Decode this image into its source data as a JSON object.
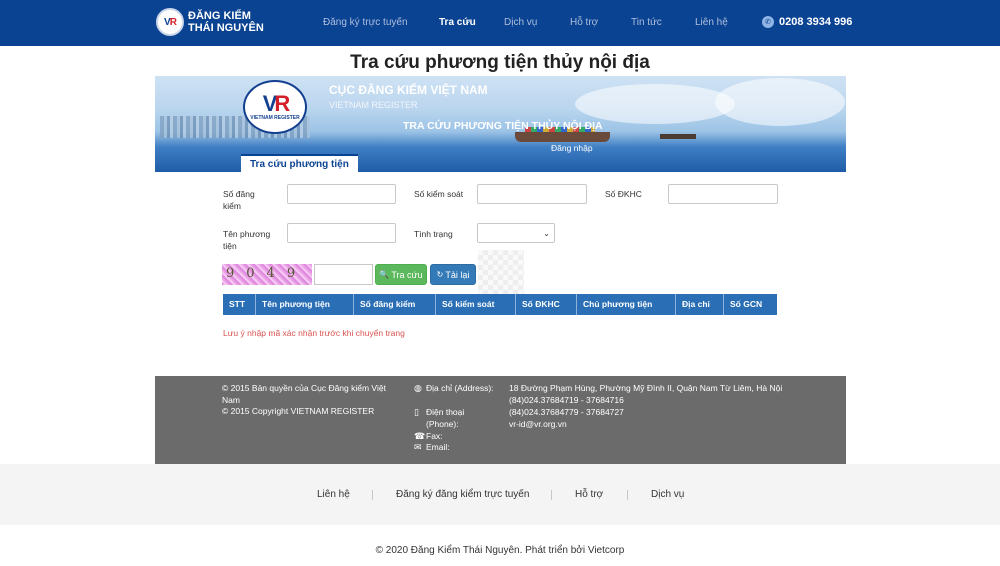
{
  "brand": {
    "logo_text": "VR",
    "line1": "ĐĂNG KIỂM",
    "line2": "THÁI NGUYÊN"
  },
  "nav": {
    "items": [
      "Đăng ký trực tuyến",
      "Tra cứu",
      "Dịch vụ",
      "Hỗ trợ",
      "Tin tức",
      "Liên hệ"
    ],
    "active": "Tra cứu",
    "phone": "0208 3934 996"
  },
  "page": {
    "title": "Tra cứu phương tiện thủy nội địa"
  },
  "banner": {
    "org_name": "CỤC ĐĂNG KIỂM VIỆT NAM",
    "org_name_en": "VIETNAM REGISTER",
    "emblem_text": "VIETNAM REGISTER",
    "subtitle": "TRA CỨU PHƯƠNG TIỆN THỦY NỘI ĐỊA",
    "login": "Đăng nhập",
    "tab": "Tra cứu phương tiện"
  },
  "form": {
    "so_dang_kiem": "Số đăng kiểm",
    "so_kiem_soat": "Số kiểm soát",
    "so_dkhc": "Số ĐKHC",
    "ten_phuong_tien": "Tên phương tiện",
    "tinh_trang": "Tình trạng",
    "captcha": "9049",
    "btn_search": "Tra cứu",
    "btn_reload": "Tải lại"
  },
  "table": {
    "columns": [
      "STT",
      "Tên phương tiện",
      "Số đăng kiểm",
      "Số kiểm soát",
      "Số ĐKHC",
      "Chủ phương tiện",
      "Địa chỉ",
      "Số GCN"
    ]
  },
  "note": "Lưu ý nhập mã xác nhận trước khi chuyển trang",
  "footer": {
    "copyright_vn": "© 2015 Bản quyền của Cục Đăng kiểm Việt Nam",
    "copyright_en": "© 2015 Copyright VIETNAM REGISTER",
    "address_label": "Địa chỉ (Address):",
    "phone_label": "Điện thoại (Phone):",
    "fax_label": "Fax:",
    "email_label": "Email:",
    "address": "18 Đường Phạm Hùng, Phường Mỹ Đình II, Quận Nam Từ Liêm, Hà Nội",
    "phone": "(84)024.37684719 - 37684716",
    "fax": "(84)024.37684779 - 37684727",
    "email": "vr-id@vr.org.vn"
  },
  "links": [
    "Liên hệ",
    "Đăng ký đăng kiểm trực tuyến",
    "Hỗ trợ",
    "Dịch vụ"
  ],
  "copyright": "© 2020 Đăng Kiểm Thái Nguyên. Phát triển bởi Vietcorp",
  "colors": {
    "nav_bg": "#0b4393",
    "table_header": "#2a6fb6",
    "footer_bg": "#6b6b6b",
    "note": "#d9534f"
  }
}
